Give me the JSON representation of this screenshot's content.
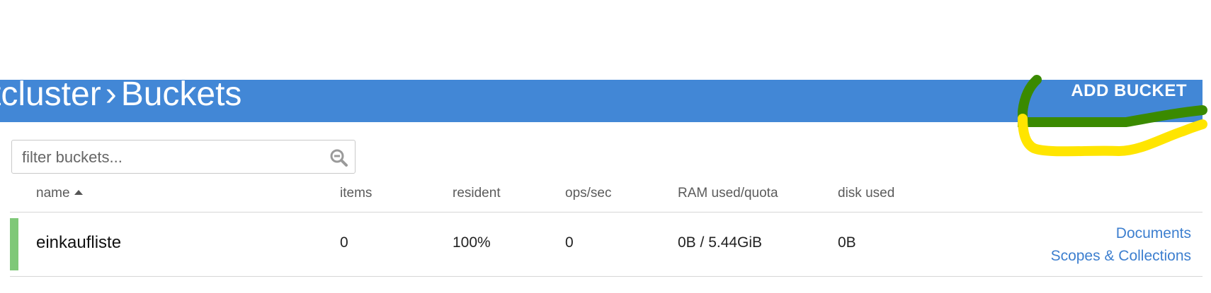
{
  "header": {
    "breadcrumb_cluster": "rstcluster",
    "breadcrumb_separator": "›",
    "breadcrumb_page": "Buckets",
    "add_bucket_label": "ADD BUCKET",
    "accent_color": "#4287d6"
  },
  "filter": {
    "placeholder": "filter buckets...",
    "value": "",
    "icon": "search-icon"
  },
  "table": {
    "columns": {
      "name": "name",
      "items": "items",
      "resident": "resident",
      "ops": "ops/sec",
      "ram": "RAM used/quota",
      "disk": "disk used"
    },
    "sort_column": "name",
    "sort_direction": "ascending",
    "rows": [
      {
        "status_color": "#7fc878",
        "name": "einkaufliste",
        "items": "0",
        "resident": "100%",
        "ops": "0",
        "ram": "0B / 5.44GiB",
        "disk": "0B",
        "links": [
          "Documents",
          "Scopes & Collections"
        ]
      }
    ]
  },
  "annotation": {
    "colors": [
      "#3a8a00",
      "#ffe500"
    ]
  }
}
